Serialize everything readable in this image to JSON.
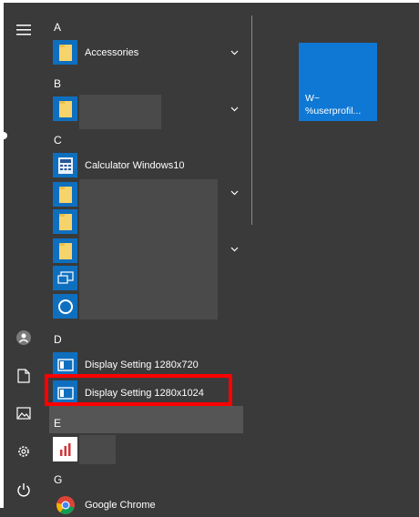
{
  "tile": {
    "line1": "W~",
    "line2": "%userprofil..."
  },
  "groups": {
    "a": "A",
    "b": "B",
    "c": "C",
    "d": "D",
    "e": "E",
    "g": "G"
  },
  "apps": {
    "accessories": "Accessories",
    "calculator": "Calculator Windows10",
    "display720": "Display Setting 1280x720",
    "display1024": "Display Setting 1280x1024",
    "chrome": "Google Chrome"
  },
  "colors": {
    "tile_blue": "#0f78d4",
    "icon_blue": "#0f6fbf",
    "highlight": "#ff0000"
  }
}
